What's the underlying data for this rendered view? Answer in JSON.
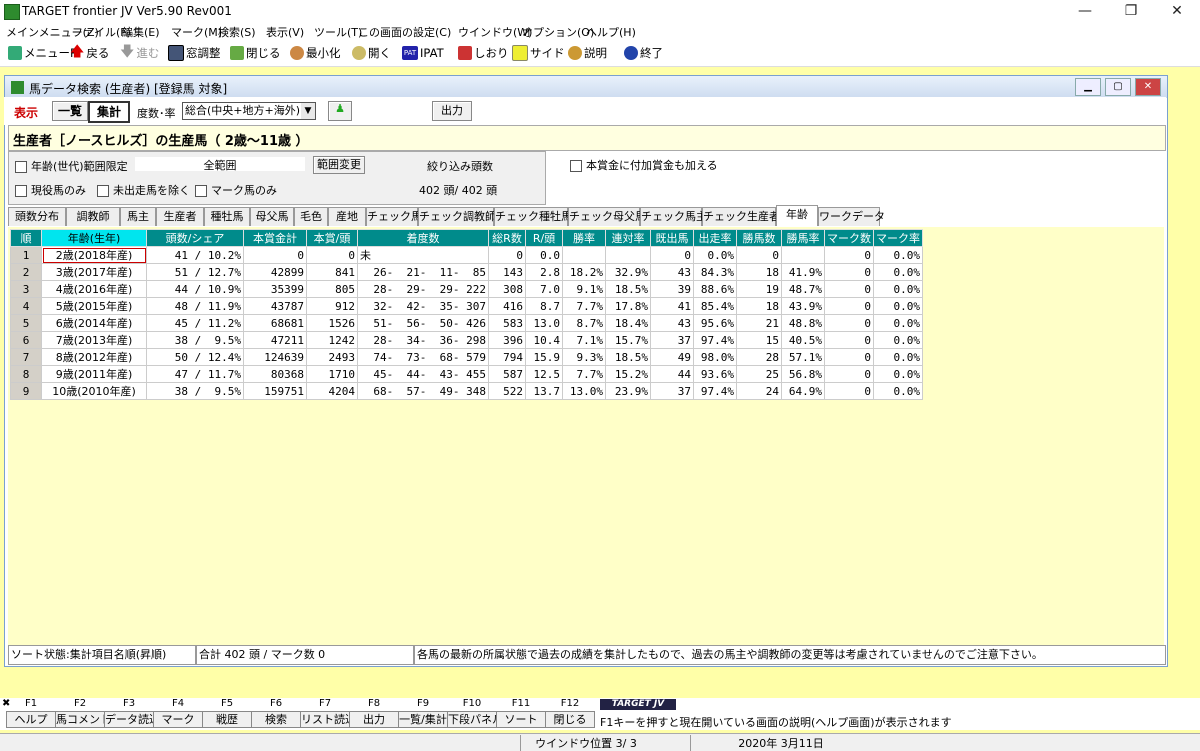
{
  "window": {
    "title": "TARGET frontier JV  Ver5.90  Rev001"
  },
  "menu": [
    "メインメニュー(Z)",
    "ファイル(F)",
    "編集(E)",
    "マーク(M)",
    "検索(S)",
    "表示(V)",
    "ツール(T)",
    "この画面の設定(C)",
    "ウインドウ(W)",
    "オプション(O)",
    "ヘルプ(H)"
  ],
  "toolbar": [
    "メニューP",
    "戻る",
    "進む",
    "窓調整",
    "閉じる",
    "最小化",
    "開く",
    "IPAT",
    "しおり",
    "サイド",
    "説明",
    "終了"
  ],
  "child": {
    "title": "馬データ検索 (生産者) [登録馬 対象]",
    "display_label": "表示",
    "list_btn": "一覧",
    "agg_btn": "集計",
    "count_rate_label": "度数･率",
    "scope_select": "総合(中央+地方+海外)",
    "output_btn": "出力",
    "heading": "生産者［ノースヒルズ］の生産馬（ 2歳～11歳 ）",
    "age_range_limit": "年齢(世代)範囲限定",
    "range_value": "全範囲",
    "range_change_btn": "範囲変更",
    "filter_label": "絞り込み頭数",
    "filter_count": "402 頭/ 402 頭",
    "active_only": "現役馬のみ",
    "exclude_unraced": "未出走馬を除く",
    "marked_only": "マーク馬のみ",
    "add_bonus": "本賞金に付加賞金も加える"
  },
  "tabs": [
    "頭数分布",
    "調教師",
    "馬主",
    "生産者",
    "種牡馬",
    "母父馬",
    "毛色",
    "産地",
    "チェック馬",
    "チェック調教師",
    "チェック種牡馬",
    "チェック母父馬",
    "チェック馬主",
    "チェック生産者",
    "年齢",
    "ワークデータ"
  ],
  "table": {
    "headers": [
      "順",
      "年齢(生年)",
      "頭数/シェア",
      "本賞金計",
      "本賞/頭",
      "着度数",
      "総R数",
      "R/頭",
      "勝率",
      "連対率",
      "既出馬",
      "出走率",
      "勝馬数",
      "勝馬率",
      "マーク数",
      "マーク率"
    ],
    "rows": [
      [
        "1",
        "2歳(2018年産)",
        "41 / 10.2%",
        "0",
        "0",
        "未",
        "0",
        "0.0",
        "",
        "",
        "0",
        "0.0%",
        "0",
        "",
        "0",
        "0.0%"
      ],
      [
        "2",
        "3歳(2017年産)",
        "51 / 12.7%",
        "42899",
        "841",
        "26-  21-  11-  85",
        "143",
        "2.8",
        "18.2%",
        "32.9%",
        "43",
        "84.3%",
        "18",
        "41.9%",
        "0",
        "0.0%"
      ],
      [
        "3",
        "4歳(2016年産)",
        "44 / 10.9%",
        "35399",
        "805",
        "28-  29-  29- 222",
        "308",
        "7.0",
        "9.1%",
        "18.5%",
        "39",
        "88.6%",
        "19",
        "48.7%",
        "0",
        "0.0%"
      ],
      [
        "4",
        "5歳(2015年産)",
        "48 / 11.9%",
        "43787",
        "912",
        "32-  42-  35- 307",
        "416",
        "8.7",
        "7.7%",
        "17.8%",
        "41",
        "85.4%",
        "18",
        "43.9%",
        "0",
        "0.0%"
      ],
      [
        "5",
        "6歳(2014年産)",
        "45 / 11.2%",
        "68681",
        "1526",
        "51-  56-  50- 426",
        "583",
        "13.0",
        "8.7%",
        "18.4%",
        "43",
        "95.6%",
        "21",
        "48.8%",
        "0",
        "0.0%"
      ],
      [
        "6",
        "7歳(2013年産)",
        "38 /  9.5%",
        "47211",
        "1242",
        "28-  34-  36- 298",
        "396",
        "10.4",
        "7.1%",
        "15.7%",
        "37",
        "97.4%",
        "15",
        "40.5%",
        "0",
        "0.0%"
      ],
      [
        "7",
        "8歳(2012年産)",
        "50 / 12.4%",
        "124639",
        "2493",
        "74-  73-  68- 579",
        "794",
        "15.9",
        "9.3%",
        "18.5%",
        "49",
        "98.0%",
        "28",
        "57.1%",
        "0",
        "0.0%"
      ],
      [
        "8",
        "9歳(2011年産)",
        "47 / 11.7%",
        "80368",
        "1710",
        "45-  44-  43- 455",
        "587",
        "12.5",
        "7.7%",
        "15.2%",
        "44",
        "93.6%",
        "25",
        "56.8%",
        "0",
        "0.0%"
      ],
      [
        "9",
        "10歳(2010年産)",
        "38 /  9.5%",
        "159751",
        "4204",
        "68-  57-  49- 348",
        "522",
        "13.7",
        "13.0%",
        "23.9%",
        "37",
        "97.4%",
        "24",
        "64.9%",
        "0",
        "0.0%"
      ]
    ]
  },
  "status": {
    "sort": "ソート状態:集計項目名順(昇順)",
    "total": "合計 402 頭 / マーク数 0",
    "note": "各馬の最新の所属状態で過去の成績を集計したもので、過去の馬主や調教師の変更等は考慮されていませんのでご注意下さい。"
  },
  "fkeys": [
    {
      "k": "F1",
      "l": "ヘルプ"
    },
    {
      "k": "F2",
      "l": "馬コメント"
    },
    {
      "k": "F3",
      "l": "データ読込"
    },
    {
      "k": "F4",
      "l": "マーク"
    },
    {
      "k": "F5",
      "l": "戦歴"
    },
    {
      "k": "F6",
      "l": "検索"
    },
    {
      "k": "F7",
      "l": "リスト読込"
    },
    {
      "k": "F8",
      "l": "出力"
    },
    {
      "k": "F9",
      "l": "一覧/集計"
    },
    {
      "k": "F10",
      "l": "下段パネル"
    },
    {
      "k": "F11",
      "l": "ソート"
    },
    {
      "k": "F12",
      "l": "閉じる"
    }
  ],
  "brand": "TARGET JV",
  "hint": "F1キーを押すと現在開いている画面の説明(ヘルプ画面)が表示されます",
  "bottom": {
    "window_pos": "ウインドウ位置 3/ 3",
    "date": "2020年 3月11日"
  }
}
